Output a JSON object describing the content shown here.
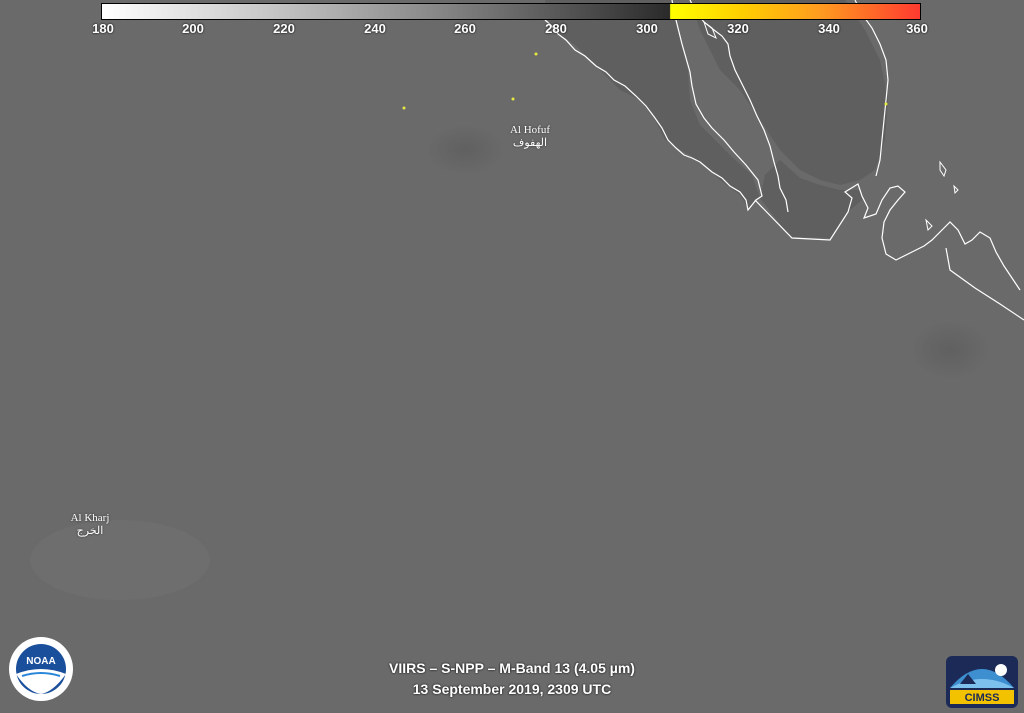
{
  "colorbar": {
    "ticks": [
      "180",
      "200",
      "220",
      "240",
      "260",
      "280",
      "300",
      "320",
      "340",
      "360"
    ],
    "min": 180,
    "max": 360,
    "color_threshold": 305,
    "colors": {
      "gray_start": "#ffffff",
      "gray_end": "#2a2a2a",
      "warm_start": "#ffff00",
      "warm_end": "#ff3a30"
    }
  },
  "cities": [
    {
      "name": "Al Hofuf",
      "arabic": "الهفوف"
    },
    {
      "name": "Al Kharj",
      "arabic": "الخرج"
    }
  ],
  "caption": {
    "line1": "VIIRS – S-NPP – M-Band 13 (4.05 µm)",
    "line2": "13 September 2019, 2309 UTC"
  },
  "logos": {
    "left": "NOAA",
    "right": "CIMSS"
  },
  "map": {
    "background": "#686868",
    "coastline_color": "#ffffff",
    "hotspot_color": "#e8e840"
  }
}
